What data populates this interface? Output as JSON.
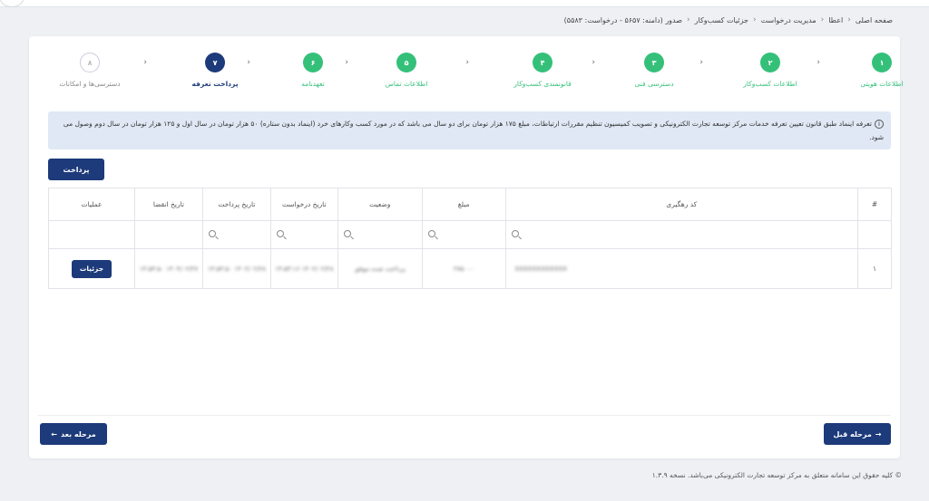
{
  "breadcrumb": {
    "items": [
      "صفحه اصلی",
      "اعطا",
      "مدیریت درخواست",
      "جزئیات کسب‌وکار",
      "صدور (دامنه: ۵۶۵۷ - درخواست: ۵۵۸۳)"
    ]
  },
  "stepper": {
    "steps": [
      {
        "num": "۱",
        "label": "اطلاعات هویتی",
        "state": "done"
      },
      {
        "num": "۲",
        "label": "اطلاعات کسب‌وکار",
        "state": "done"
      },
      {
        "num": "۳",
        "label": "دسترسی فنی",
        "state": "done"
      },
      {
        "num": "۴",
        "label": "قانونمندی کسب‌وکار",
        "state": "done"
      },
      {
        "num": "۵",
        "label": "اطلاعات تماس",
        "state": "done"
      },
      {
        "num": "۶",
        "label": "تعهدنامه",
        "state": "done"
      },
      {
        "num": "۷",
        "label": "پرداخت تعرفه",
        "state": "active"
      },
      {
        "num": "۸",
        "label": "دسترسی‌ها و امکانات",
        "state": "pending"
      }
    ]
  },
  "info": {
    "text": "تعرفه اینماد طبق قانون تعیین تعرفه خدمات مرکز توسعه تجارت الکترونیکی و تصویب کمیسیون تنظیم مقررات ارتباطات، مبلغ ۱۷۵ هزار تومان برای دو سال می باشد که در مورد کسب وکارهای خرد (اینماد بدون ستاره) ۵۰ هزار تومان در سال اول و ۱۲۵ هزار تومان در سال دوم وصول می شود."
  },
  "pay_button": "پرداخت",
  "table": {
    "headers": {
      "index": "#",
      "tracking": "کد رهگیری",
      "amount": "مبلغ",
      "status": "وضعیت",
      "request_date": "تاریخ درخواست",
      "payment_date": "تاریخ پرداخت",
      "expiry_date": "تاریخ انقضا",
      "actions": "عملیات"
    },
    "rows": [
      {
        "index": "۱",
        "tracking": "XXXXXXXXXXXX",
        "amount": "۲۷۵۰۰۰",
        "status": "پرداخت شده موفق",
        "request_date": "۱۴۰۲/۰۲/۲۸ ۱۴:۵۳:۱۶",
        "payment_date": "۱۴۰۲/۰۲/۲۸ ۱۴:۵۳:۵۰",
        "expiry_date": "۱۴۰۴/۰۲/۲۷ ۱۴:۵۳:۵۰",
        "action_label": "جزئیات"
      }
    ]
  },
  "nav": {
    "prev": "مرحله قبل",
    "next": "مرحله بعد"
  },
  "footer": "© کلیه حقوق این سامانه متعلق به مرکز توسعه تجارت الکترونیکی می‌باشد. نسخه ۱.۳.۹",
  "colors": {
    "primary": "#1d3a7a",
    "success": "#35c07a",
    "info_bg": "#dfe8f4"
  }
}
